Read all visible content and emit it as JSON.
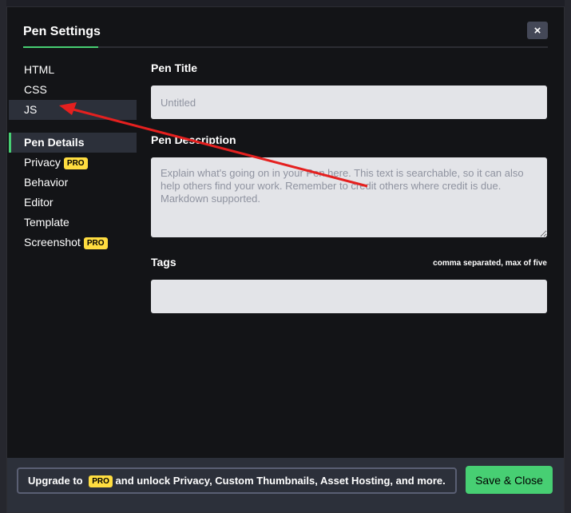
{
  "modal": {
    "title": "Pen Settings",
    "close_symbol": "×"
  },
  "sidebar": {
    "editor_items": [
      {
        "label": "HTML"
      },
      {
        "label": "CSS"
      },
      {
        "label": "JS"
      }
    ],
    "settings_items": [
      {
        "label": "Pen Details",
        "active": true
      },
      {
        "label": "Privacy",
        "badge": "PRO"
      },
      {
        "label": "Behavior"
      },
      {
        "label": "Editor"
      },
      {
        "label": "Template"
      },
      {
        "label": "Screenshot",
        "badge": "PRO"
      }
    ]
  },
  "main": {
    "title_field": {
      "label": "Pen Title",
      "placeholder": "Untitled",
      "value": ""
    },
    "description_field": {
      "label": "Pen Description",
      "placeholder": "Explain what's going on in your Pen here. This text is searchable, so it can also help others find your work. Remember to credit others where credit is due. Markdown supported."
    },
    "tags_field": {
      "label": "Tags",
      "hint": "comma separated, max of five",
      "value": ""
    }
  },
  "footer": {
    "upgrade_prefix": "Upgrade to",
    "upgrade_badge": "PRO",
    "upgrade_suffix": "and unlock Privacy, Custom Thumbnails, Asset Hosting, and more.",
    "save_label": "Save & Close"
  },
  "colors": {
    "accent_green": "#47cf73",
    "pro_yellow": "#ffdd40",
    "annotation_red": "#e5201f"
  }
}
